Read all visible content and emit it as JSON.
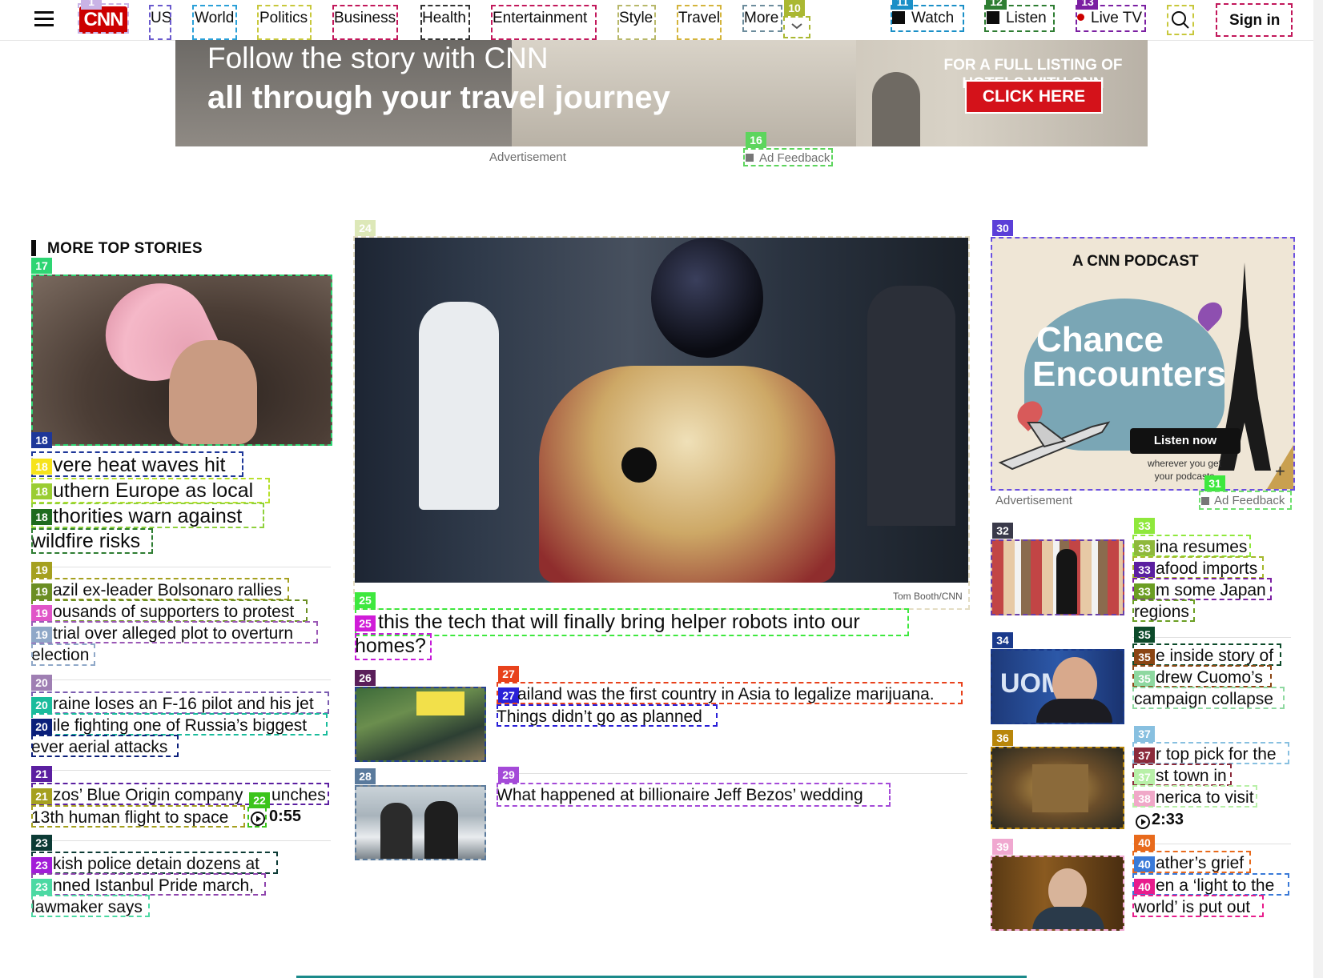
{
  "header": {
    "logo": "CNN",
    "nav": [
      "US",
      "World",
      "Politics",
      "Business",
      "Health",
      "Entertainment",
      "Style",
      "Travel",
      "More"
    ],
    "watch": "Watch",
    "listen": "Listen",
    "live_tv": "Live TV",
    "sign_in": "Sign in"
  },
  "ad_banner": {
    "line1": "Follow the story with CNN",
    "line2": "all through your travel journey",
    "right_text": "FOR A FULL LISTING OF HOTELS WITH CNN",
    "cta": "CLICK HERE",
    "label": "Advertisement",
    "feedback": "Ad Feedback"
  },
  "left": {
    "section_title": "MORE TOP STORIES",
    "stories": [
      {
        "line1": "vere heat waves hit",
        "line2": "uthern Europe as local",
        "line3": "thorities warn against",
        "line4": "wildfire risks"
      },
      {
        "line1": "azil ex-leader Bolsonaro rallies",
        "line2": "ousands of supporters to protest",
        "line3": "trial over alleged plot to overturn",
        "line4": "election"
      },
      {
        "line1": "raine loses an F-16 pilot and his jet",
        "line2": "ile fighting one of Russia’s biggest",
        "line3": "ever aerial attacks"
      },
      {
        "line1": "zos’ Blue Origin company",
        "line1b": "unches",
        "line2": "13th human flight to space",
        "duration": "0:55"
      },
      {
        "line1": "kish police detain dozens at",
        "line2": "nned Istanbul Pride march,",
        "line3": "lawmaker says"
      }
    ]
  },
  "center": {
    "photo_credit": "Tom Booth/CNN",
    "main_headline_l1": "this the tech that will finally bring helper robots into our",
    "main_headline_l2": "homes?",
    "story_a_l1": "ailand was the first country in Asia to legalize marijuana.",
    "story_a_l2": "Things didn’t go as planned",
    "story_b": "What happened at billionaire Jeff Bezos’ wedding"
  },
  "right": {
    "podcast_brand": "A CNN PODCAST",
    "podcast_title_1": "Chance",
    "podcast_title_2": "Encounters",
    "podcast_cta": "Listen now",
    "podcast_sub_1": "wherever you get",
    "podcast_sub_2": "your podcasts",
    "ad_label": "Advertisement",
    "ad_feedback": "Ad Feedback",
    "stories": [
      {
        "line1": "ina resumes",
        "line2": "afood imports",
        "line3": "m some Japan",
        "line4": "regions"
      },
      {
        "line1": "e inside story of",
        "line2": "drew Cuomo’s",
        "line3": "campaign collapse"
      },
      {
        "line1": "r top pick for the",
        "line2": "st town in",
        "line3": "nerica to visit",
        "duration": "2:33"
      },
      {
        "line1": "ather’s grief",
        "line2": "en a ‘light to the",
        "line3": "world’ is put out"
      }
    ]
  },
  "tags": [
    "1",
    "10",
    "11",
    "12",
    "13",
    "16",
    "17",
    "18",
    "19",
    "20",
    "21",
    "22",
    "23",
    "24",
    "25",
    "26",
    "27",
    "28",
    "29",
    "30",
    "31",
    "32",
    "33",
    "34",
    "35",
    "36",
    "37",
    "38",
    "39",
    "40"
  ]
}
